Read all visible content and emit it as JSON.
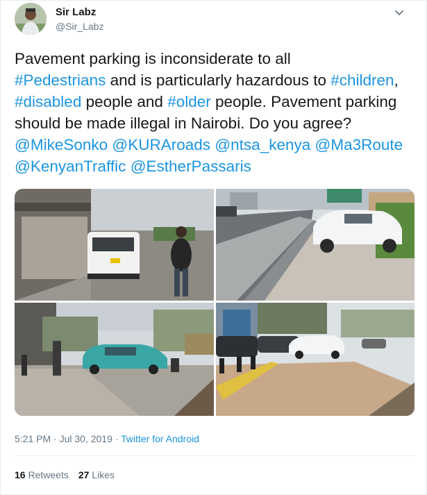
{
  "author": {
    "display_name": "Sir Labz",
    "handle": "@Sir_Labz",
    "avatar_icon": "avatar-photo"
  },
  "menu_icon": "chevron-down-icon",
  "tweet": {
    "lines": [
      [
        {
          "t": "Pavement parking is inconsiderate to all",
          "link": false
        }
      ],
      [
        {
          "t": "#Pedestrians",
          "link": true
        },
        {
          "t": " and is particularly hazardous to ",
          "link": false
        },
        {
          "t": "#children",
          "link": true
        },
        {
          "t": ",",
          "link": false
        }
      ],
      [
        {
          "t": "#disabled",
          "link": true
        },
        {
          "t": " people and ",
          "link": false
        },
        {
          "t": "#older",
          "link": true
        },
        {
          "t": " people. Pavement parking",
          "link": false
        }
      ],
      [
        {
          "t": "should be made illegal in Nairobi. Do you agree?",
          "link": false
        }
      ],
      [
        {
          "t": "@MikeSonko",
          "link": true
        },
        {
          "t": " ",
          "link": false
        },
        {
          "t": "@KURAroads",
          "link": true
        },
        {
          "t": " ",
          "link": false
        },
        {
          "t": "@ntsa_kenya",
          "link": true
        },
        {
          "t": " ",
          "link": false
        },
        {
          "t": "@Ma3Route",
          "link": true
        }
      ],
      [
        {
          "t": " @KenyanTraffic",
          "link": true
        },
        {
          "t": " ",
          "link": false
        },
        {
          "t": "@EstherPassaris",
          "link": true
        }
      ]
    ]
  },
  "media": {
    "photo_count": 4
  },
  "timestamp": {
    "time_date": "5:21 PM · Jul 30, 2019 · ",
    "source": "Twitter for Android"
  },
  "stats": {
    "retweets_count": "16",
    "retweets_label": "Retweets",
    "likes_count": "27",
    "likes_label": "Likes"
  },
  "colors": {
    "link": "#1b95e0",
    "secondary_text": "#657786",
    "divider": "#e6ecf0"
  }
}
